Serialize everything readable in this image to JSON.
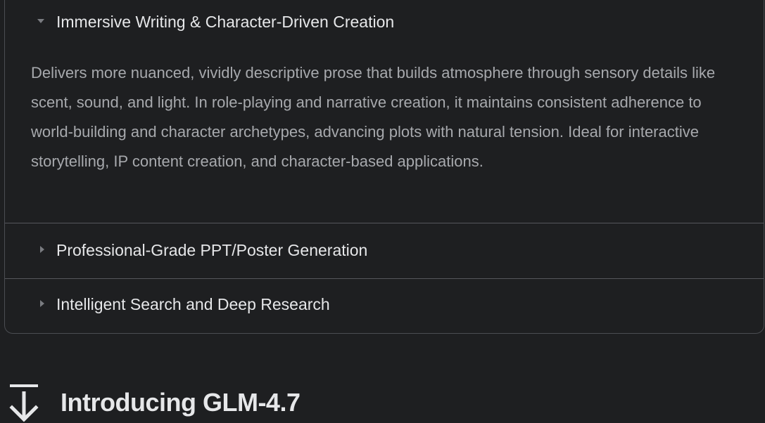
{
  "accordion": {
    "items": [
      {
        "title": "Immersive Writing & Character-Driven Creation",
        "expanded": true,
        "body": "Delivers more nuanced, vividly descriptive prose that builds atmosphere through sensory details like scent, sound, and light. In role-playing and narrative creation, it maintains consistent adherence to world-building and character archetypes, advancing plots with natural tension. Ideal for interactive storytelling, IP content creation, and character-based applications."
      },
      {
        "title": "Professional-Grade PPT/Poster Generation",
        "expanded": false
      },
      {
        "title": "Intelligent Search and Deep Research",
        "expanded": false
      }
    ]
  },
  "section": {
    "title": "Introducing GLM-4.7",
    "icon": "download-icon"
  },
  "colors": {
    "background": "#1e1f21",
    "border": "#4b4d52",
    "title_text": "#e6e7e9",
    "body_text": "#a7a9ad",
    "caret": "#7a7c81"
  }
}
